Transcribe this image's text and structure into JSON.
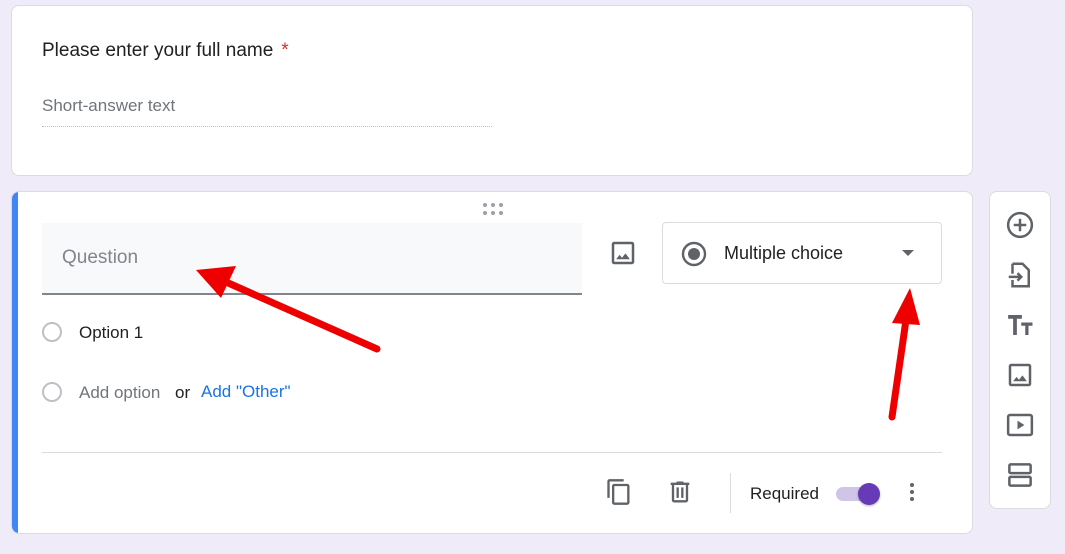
{
  "question1": {
    "title": "Please enter your full name",
    "required_marker": "*",
    "placeholder": "Short-answer text"
  },
  "question2": {
    "title_placeholder": "Question",
    "type_selector": {
      "icon": "radio-checked-icon",
      "value": "Multiple choice"
    },
    "options": [
      {
        "label": "Option 1"
      }
    ],
    "add_option": {
      "label": "Add option",
      "or": "or",
      "add_other": "Add \"Other\""
    },
    "footer": {
      "required_label": "Required",
      "required_on": true
    }
  },
  "side_toolbar": [
    {
      "name": "add-question-icon"
    },
    {
      "name": "import-questions-icon"
    },
    {
      "name": "add-title-icon"
    },
    {
      "name": "add-image-icon"
    },
    {
      "name": "add-video-icon"
    },
    {
      "name": "add-section-icon"
    }
  ],
  "colors": {
    "background": "#f0ebf8",
    "accent_bar": "#4285f4",
    "toggle": "#673ab7",
    "link": "#1a73e8",
    "required_star": "#d93025",
    "annotation_arrows": "#ee0000"
  }
}
